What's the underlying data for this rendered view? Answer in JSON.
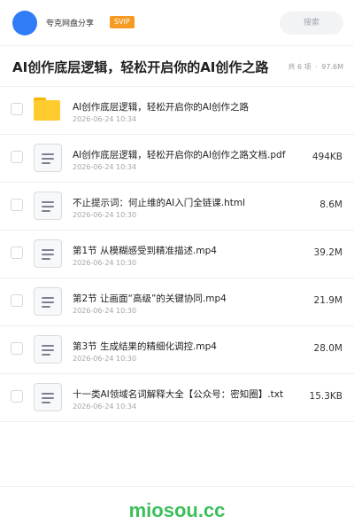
{
  "header": {
    "user_name": "夸克网盘分享",
    "vip_label": "SVIP",
    "search_placeholder": "搜索"
  },
  "folder": {
    "title": "AI创作底层逻辑，轻松开启你的AI创作之路",
    "count_label": "共 6 项",
    "separator": "·",
    "total_size": "97.6M"
  },
  "files": [
    {
      "name": "AI创作底层逻辑，轻松开启你的AI创作之路",
      "date": "2026-06-24 10:34",
      "size": "",
      "icon": "folder-icon"
    },
    {
      "name": "AI创作底层逻辑，轻松开启你的AI创作之路文档.pdf",
      "date": "2026-06-24 10:34",
      "size": "494KB",
      "icon": "document-icon"
    },
    {
      "name": "不止提示词：何止维的AI入门全链课.html",
      "date": "2026-06-24 10:30",
      "size": "8.6M",
      "icon": "document-icon"
    },
    {
      "name": "第1节 从模糊感受到精准描述.mp4",
      "date": "2026-06-24 10:30",
      "size": "39.2M",
      "icon": "document-icon"
    },
    {
      "name": "第2节 让画面“高级”的关键协同.mp4",
      "date": "2026-06-24 10:30",
      "size": "21.9M",
      "icon": "document-icon"
    },
    {
      "name": "第3节 生成结果的精细化调控.mp4",
      "date": "2026-06-24 10:30",
      "size": "28.0M",
      "icon": "document-icon"
    },
    {
      "name": "十一类AI领域名词解释大全【公众号：密知圈】.txt",
      "date": "2026-06-24 10:34",
      "size": "15.3KB",
      "icon": "document-icon"
    }
  ],
  "watermark": "miosou.cc",
  "colors": {
    "accent": "#2f7cf6",
    "vip": "#f59a23",
    "folder": "#ffcb2e",
    "watermark": "#3cbf5a"
  }
}
